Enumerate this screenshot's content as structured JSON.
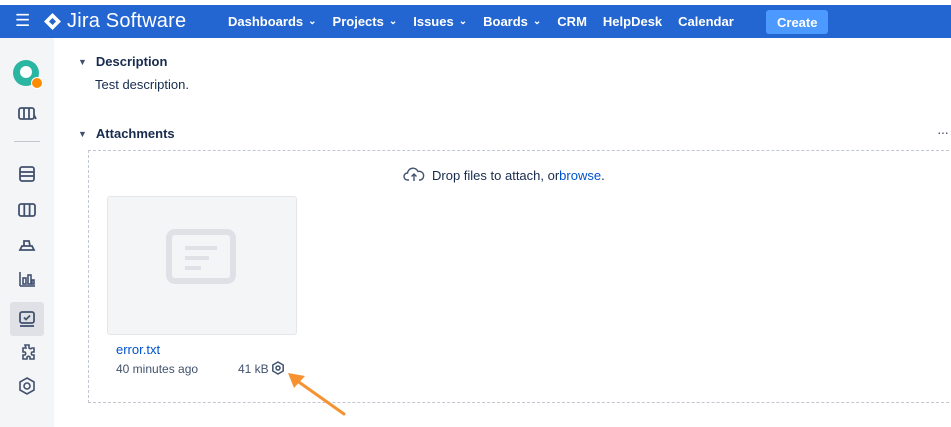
{
  "colors": {
    "topbar": "#2365d1",
    "create": "#4c9aff",
    "link": "#0052cc",
    "arrow": "#f79233",
    "sidebar": "#f4f5f7"
  },
  "topbar": {
    "logo_text": "Jira Software",
    "menu_icon": "hamburger-icon",
    "nav": [
      {
        "label": "Dashboards",
        "dropdown": true
      },
      {
        "label": "Projects",
        "dropdown": true
      },
      {
        "label": "Issues",
        "dropdown": true
      },
      {
        "label": "Boards",
        "dropdown": true
      },
      {
        "label": "CRM",
        "dropdown": false
      },
      {
        "label": "HelpDesk",
        "dropdown": false
      },
      {
        "label": "Calendar",
        "dropdown": false
      }
    ],
    "create_label": "Create"
  },
  "sidebar": {
    "icons": [
      "project-avatar-icon",
      "board-icon",
      "backlog-icon",
      "columns-icon",
      "releases-icon",
      "reports-icon",
      "issues-icon",
      "add-ons-icon",
      "settings-icon"
    ]
  },
  "description": {
    "title": "Description",
    "text": "Test description."
  },
  "attachments": {
    "title": "Attachments",
    "more": "···",
    "drop_text": "Drop files to attach, or ",
    "browse_link": "browse",
    "drop_suffix": ".",
    "files": [
      {
        "name": "error.txt",
        "time": "40 minutes ago",
        "size": "41 kB",
        "icon": "text-file-icon"
      }
    ]
  }
}
